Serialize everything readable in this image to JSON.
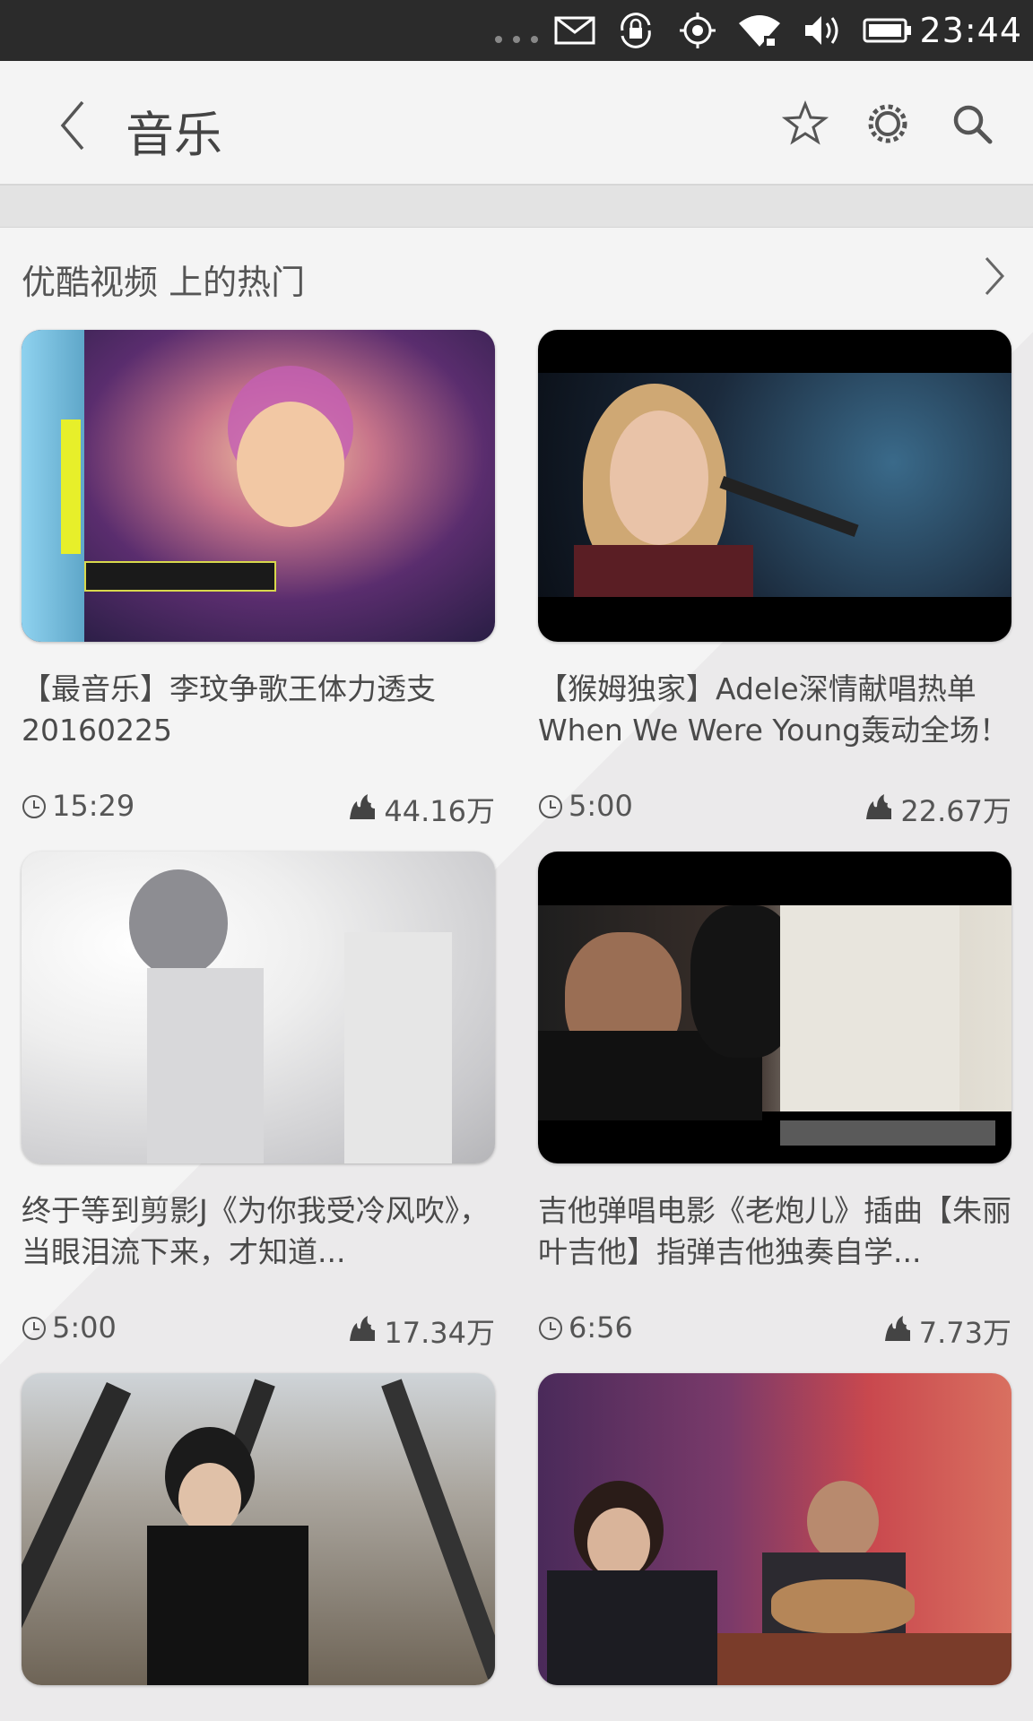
{
  "status_bar": {
    "time": "23:44",
    "icons": [
      "more-dots-icon",
      "mail-icon",
      "rotation-lock-icon",
      "location-icon",
      "wifi-icon",
      "volume-icon",
      "battery-icon"
    ]
  },
  "header": {
    "title": "音乐",
    "icons": [
      "back-icon",
      "star-icon",
      "gear-icon",
      "search-icon"
    ]
  },
  "section": {
    "title": "优酷视频 上的热门"
  },
  "videos": [
    {
      "title": "【最音乐】李玟争歌王体力透支20160225",
      "duration": "15:29",
      "views": "44.16万"
    },
    {
      "title": "【猴姆独家】Adele深情献唱热单When We Were Young轰动全场！",
      "duration": "5:00",
      "views": "22.67万"
    },
    {
      "title": "终于等到剪影J《为你我受冷风吹》，当眼泪流下来，才知道...",
      "duration": "5:00",
      "views": "17.34万"
    },
    {
      "title": "吉他弹唱电影《老炮儿》插曲【朱丽叶吉他】指弹吉他独奏自学...",
      "duration": "6:56",
      "views": "7.73万"
    },
    {
      "title": "",
      "duration": "",
      "views": ""
    },
    {
      "title": "",
      "duration": "",
      "views": ""
    }
  ]
}
